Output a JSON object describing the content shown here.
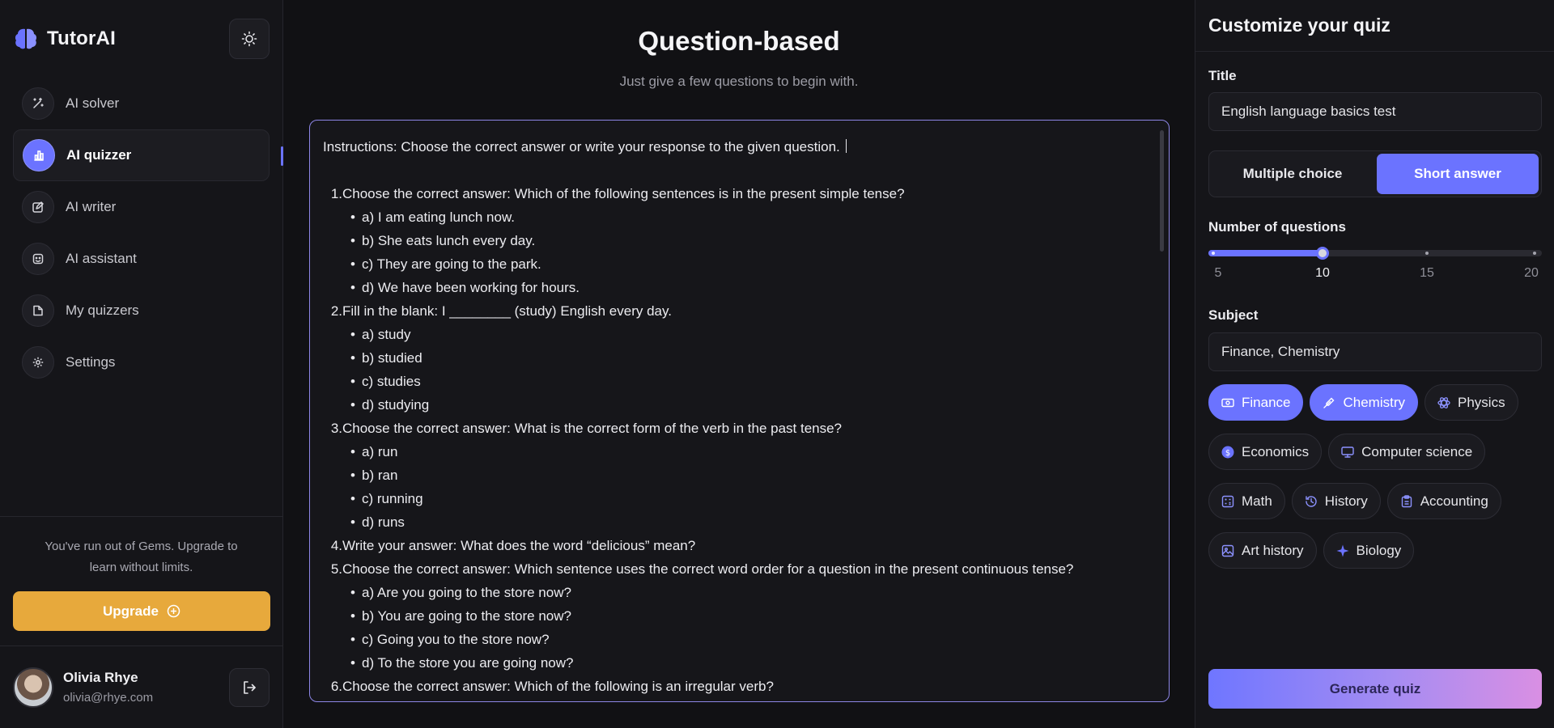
{
  "brand": {
    "name": "TutorAI",
    "logo_icon": "brain-icon"
  },
  "sidebar": {
    "theme_toggle_icon": "sun-icon",
    "items": [
      {
        "label": "AI solver",
        "icon": "magic-wand-icon",
        "active": false
      },
      {
        "label": "AI quizzer",
        "icon": "bar-chart-icon",
        "active": true
      },
      {
        "label": "AI writer",
        "icon": "edit-icon",
        "active": false
      },
      {
        "label": "AI assistant",
        "icon": "robot-face-icon",
        "active": false
      },
      {
        "label": "My quizzers",
        "icon": "folder-icon",
        "active": false
      },
      {
        "label": "Settings",
        "icon": "gear-icon",
        "active": false
      }
    ],
    "upgrade": {
      "text": "You've run out of Gems. Upgrade to learn without limits.",
      "button_label": "Upgrade"
    },
    "user": {
      "name": "Olivia Rhye",
      "email": "olivia@rhye.com"
    }
  },
  "main": {
    "title": "Question-based",
    "subtitle": "Just give a few questions to begin with.",
    "editor": {
      "instructions": "Instructions: Choose the correct answer or write your response to the given question.",
      "questions": [
        {
          "num": "1.",
          "text": "Choose the correct answer: Which of the following sentences is in the present simple tense?",
          "options": [
            "a) I am eating lunch now.",
            "b) She eats lunch every day.",
            "c) They are going to the park.",
            "d) We have been working for hours."
          ]
        },
        {
          "num": "2.",
          "text": "Fill in the blank: I ________ (study) English every day.",
          "options": [
            "a) study",
            "b) studied",
            "c) studies",
            "d) studying"
          ]
        },
        {
          "num": "3.",
          "text": "Choose the correct answer: What is the correct form of the verb in the past tense?",
          "options": [
            "a) run",
            "b) ran",
            "c) running",
            "d) runs"
          ]
        },
        {
          "num": "4.",
          "text": "Write your answer: What does the word “delicious” mean?",
          "options": []
        },
        {
          "num": "5.",
          "text": "Choose the correct answer: Which sentence uses the correct word order for a question in the present continuous tense?",
          "options": [
            "a) Are you going to the store now?",
            "b) You are going to the store now?",
            "c) Going you to the store now?",
            "d) To the store you are going now?"
          ]
        },
        {
          "num": "6.",
          "text": "Choose the correct answer: Which of the following is an irregular verb?",
          "options": []
        }
      ]
    }
  },
  "panel": {
    "title": "Customize your quiz",
    "title_label": "Title",
    "title_value": "English language basics test",
    "question_types": [
      {
        "label": "Multiple choice",
        "active": false
      },
      {
        "label": "Short answer",
        "active": true
      }
    ],
    "num_questions_label": "Number of questions",
    "num_questions": {
      "options": [
        "5",
        "10",
        "15",
        "20"
      ],
      "selected": "10",
      "fill_fraction": 0.333
    },
    "subject_label": "Subject",
    "subject_value": "Finance, Chemistry",
    "subjects": [
      {
        "label": "Finance",
        "icon": "money-icon",
        "selected": true
      },
      {
        "label": "Chemistry",
        "icon": "pipette-icon",
        "selected": true
      },
      {
        "label": "Physics",
        "icon": "atom-icon",
        "selected": false
      },
      {
        "label": "Economics",
        "icon": "coin-icon",
        "selected": false
      },
      {
        "label": "Computer science",
        "icon": "monitor-icon",
        "selected": false
      },
      {
        "label": "Math",
        "icon": "calculator-icon",
        "selected": false
      },
      {
        "label": "History",
        "icon": "clock-history-icon",
        "selected": false
      },
      {
        "label": "Accounting",
        "icon": "clipboard-icon",
        "selected": false
      },
      {
        "label": "Art history",
        "icon": "image-icon",
        "selected": false
      },
      {
        "label": "Biology",
        "icon": "sparkle-icon",
        "selected": false
      }
    ],
    "generate_label": "Generate quiz"
  },
  "colors": {
    "accent": "#6b73ff",
    "upgrade": "#e7a93c",
    "background": "#111114"
  }
}
